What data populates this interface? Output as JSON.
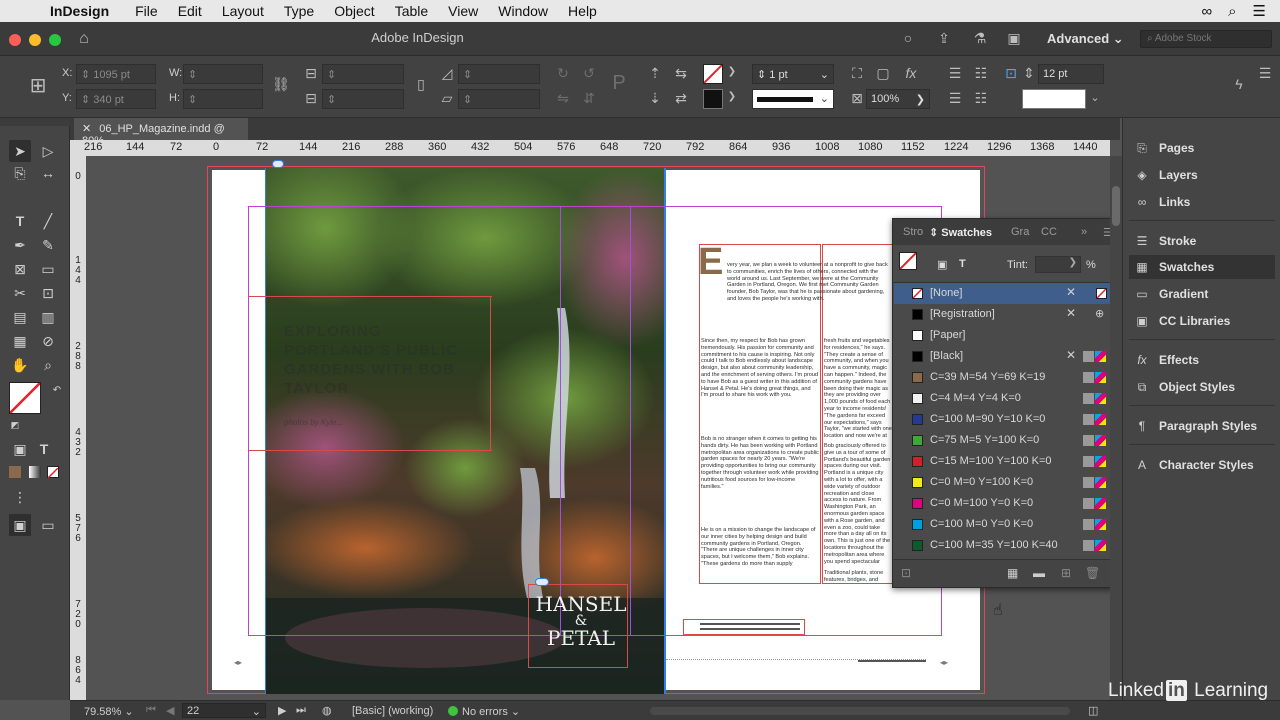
{
  "menubar": {
    "app_name": "InDesign",
    "items": [
      "File",
      "Edit",
      "Layout",
      "Type",
      "Object",
      "Table",
      "View",
      "Window",
      "Help"
    ]
  },
  "window": {
    "title": "Adobe InDesign",
    "workspace": "Advanced",
    "search_placeholder": "Adobe Stock"
  },
  "control_bar": {
    "x_label": "X:",
    "x_value": "1095 pt",
    "y_label": "Y:",
    "y_value": "340 pt",
    "w_label": "W:",
    "h_label": "H:",
    "stroke_weight": "1 pt",
    "opacity": "100%",
    "leading": "12 pt"
  },
  "document_tab": {
    "label": "06_HP_Magazine.indd @ 80%"
  },
  "rulers": {
    "horizontal": [
      "216",
      "144",
      "72",
      "0",
      "72",
      "144",
      "216",
      "288",
      "360",
      "432",
      "504",
      "576",
      "648",
      "720",
      "792",
      "864",
      "936",
      "1008",
      "1080",
      "1152",
      "1224",
      "1296",
      "1368",
      "1440"
    ],
    "vertical": [
      "0",
      "1 4 4",
      "2 8 8",
      "4 3 2",
      "5 7 6",
      "7 2 0",
      "8 6 4"
    ]
  },
  "layout": {
    "headline": "EXPLORING PORTLAND'S PUBLIC GARDENS WITH BOB TAYLOR",
    "byline": "photos by Kyle...",
    "logo_top": "HANSEL",
    "logo_amp": "&",
    "logo_bottom": "PETAL",
    "dropcap": "E",
    "col1_intro": "very year, we plan a week to volunteer at a nonprofit to give back to communities, enrich the lives of others, connected with the world around us. Last September, we were at the Community Garden in Portland, Oregon. We first met Community Garden founder, Bob Taylor, was that he is passionate about gardening, and loves the people he's working with.",
    "col1_a": "Since then, my respect for Bob has grown tremendously. His passion for community and commitment to his cause is inspiring. Not only could I talk to Bob endlessly about landscape design, but also about community leadership, and the enrichment of serving others. I'm proud to have Bob as a guest writer in this addition of Hansel & Petal. He's doing great things, and I'm proud to share his work with you.",
    "col1_b": "Bob is no stranger when it comes to getting his hands dirty. He has been working with Portland metropolitan area organizations to create public garden spaces for nearly 20 years. \"We're providing opportunities to bring our community together through volunteer work while providing nutritious food sources for low-income families.\"",
    "col1_c": "He is on a mission to change the landscape of our inner cities by helping design and build community gardens in Portland, Oregon. \"There are unique challenges in inner city spaces, but I welcome them,\" Bob explains. \"These gardens do more than supply",
    "col2_a": "fresh fruits and vegetables for residences,\" he says. \"They create a sense of community, and when you have a community, magic can happen.\" Indeed, the community gardens have been doing their magic as they are providing over 1,000 pounds of food each year to income residents! \"The gardens far exceed our expectations,\" says Taylor, \"we started with one location and now we're at seven. We will yield 100 pounds of food.\"",
    "col2_b": "Bob graciously offered to give us a tour of some of Portland's beautiful garden spaces during our visit. Portland is a unique city with a lot to offer, with a wide variety of outdoor recreation and close access to nature. From Washington Park, an enormous garden space with a Rose garden, and even a zoo, could take more than a day all on its own. This is just one of the locations throughout the metropolitan area where you spend spectacular public gardens.",
    "col2_c": "Traditional plants, stone features, bridges, and"
  },
  "swatches_panel": {
    "tabs": [
      "Stro",
      "Swatches",
      "Gra",
      "CC"
    ],
    "tint_label": "Tint:",
    "tint_unit": "%",
    "rows": [
      {
        "name": "[None]",
        "color": "none",
        "selected": true
      },
      {
        "name": "[Registration]",
        "color": "#000000"
      },
      {
        "name": "[Paper]",
        "color": "#ffffff"
      },
      {
        "name": "[Black]",
        "color": "#000000"
      },
      {
        "name": "C=39 M=54 Y=69 K=19",
        "color": "#8a6a4a"
      },
      {
        "name": "C=4 M=4 Y=4 K=0",
        "color": "#f2f2f2"
      },
      {
        "name": "C=100 M=90 Y=10 K=0",
        "color": "#233b94"
      },
      {
        "name": "C=75 M=5 Y=100 K=0",
        "color": "#3ea63a"
      },
      {
        "name": "C=15 M=100 Y=100 K=0",
        "color": "#d0202a"
      },
      {
        "name": "C=0 M=0 Y=100 K=0",
        "color": "#f5eb14"
      },
      {
        "name": "C=0 M=100 Y=0 K=0",
        "color": "#e3007e"
      },
      {
        "name": "C=100 M=0 Y=0 K=0",
        "color": "#00a0e0"
      },
      {
        "name": "C=100 M=35 Y=100 K=40",
        "color": "#0e5a2c"
      }
    ]
  },
  "dock": {
    "items": [
      "Pages",
      "Layers",
      "Links",
      "Stroke",
      "Swatches",
      "Gradient",
      "CC Libraries",
      "Effects",
      "Object Styles",
      "Paragraph Styles",
      "Character Styles"
    ]
  },
  "status_bar": {
    "zoom": "79.58%",
    "page": "22",
    "style": "[Basic] (working)",
    "preflight": "No errors"
  },
  "watermark": {
    "brand_a": "Linked",
    "brand_in": "in",
    "brand_b": "Learning"
  }
}
